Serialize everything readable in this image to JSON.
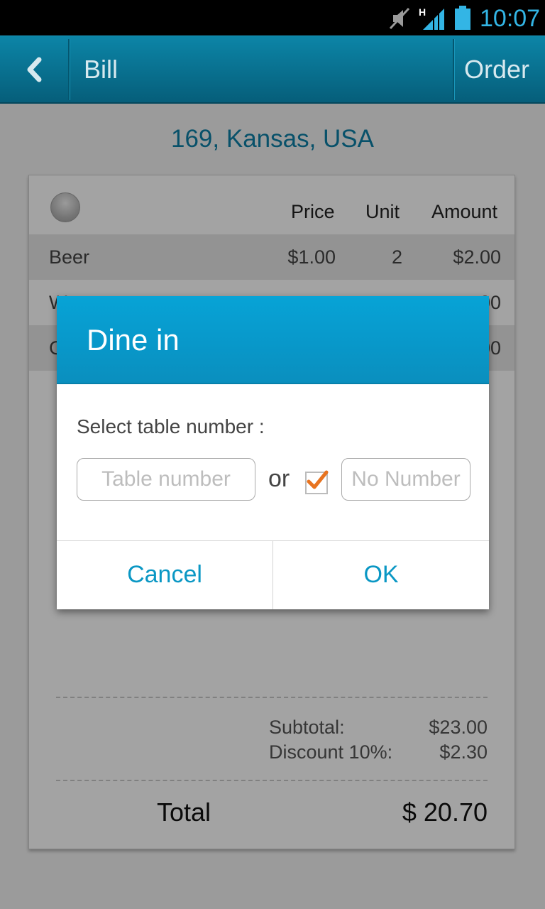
{
  "status_bar": {
    "time": "10:07",
    "network_label": "H",
    "icons": [
      "mute-icon",
      "signal-icon",
      "battery-icon"
    ]
  },
  "action_bar": {
    "back_icon": "chevron-left-icon",
    "title": "Bill",
    "order_label": "Order"
  },
  "address": "169, Kansas, USA",
  "bill_table": {
    "headers": {
      "price": "Price",
      "unit": "Unit",
      "amount": "Amount"
    },
    "rows": [
      {
        "item": "Beer",
        "price": "$1.00",
        "unit": "2",
        "amount": "$2.00"
      },
      {
        "item": "W",
        "price": "",
        "unit": "",
        "amount": "00"
      },
      {
        "item": "C",
        "price": "",
        "unit": "",
        "amount": "00"
      }
    ]
  },
  "summary": {
    "subtotal_label": "Subtotal:",
    "subtotal_value": "$23.00",
    "discount_label": "Discount 10%:",
    "discount_value": "$2.30",
    "total_label": "Total",
    "total_value": "$ 20.70"
  },
  "dialog": {
    "title": "Dine in",
    "label": "Select table number :",
    "table_placeholder": "Table number",
    "or_text": "or",
    "no_number_checked": true,
    "no_number_placeholder": "No Number",
    "cancel_label": "Cancel",
    "ok_label": "OK"
  },
  "colors": {
    "accent": "#0a97c4",
    "action_bar": "#076f8f",
    "status_time": "#33b5e5",
    "check": "#e8731f"
  }
}
